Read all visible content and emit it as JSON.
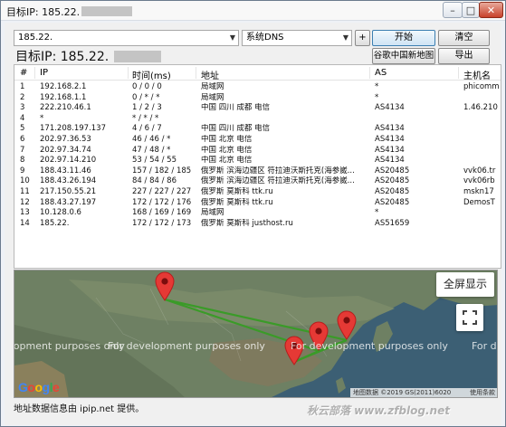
{
  "window": {
    "title": "目标IP: 185.22.",
    "minimize": "–",
    "maximize": "□",
    "close": "✕"
  },
  "toolbar": {
    "target_value": "185.22.",
    "dns_value": "系统DNS",
    "plus_label": "+",
    "start_label": "开始",
    "clear_label": "清空",
    "google_map_label": "谷歌中国新地图",
    "export_label": "导出",
    "big_target_label": "目标IP:  185.22."
  },
  "table": {
    "headers": {
      "num": "#",
      "ip": "IP",
      "time": "时间(ms)",
      "addr": "地址",
      "as": "AS",
      "host": "主机名"
    },
    "rows": [
      {
        "num": "1",
        "ip": "192.168.2.1",
        "time": "0 / 0 / 0",
        "addr": "局域网",
        "as": "*",
        "host": "phicomm"
      },
      {
        "num": "2",
        "ip": "192.168.1.1",
        "time": "0 / * / *",
        "addr": "局域网",
        "as": "*",
        "host": ""
      },
      {
        "num": "3",
        "ip": "222.210.46.1",
        "time": "1 / 2 / 3",
        "addr": "中国 四川 成都 电信",
        "as": "AS4134",
        "host": "1.46.210"
      },
      {
        "num": "4",
        "ip": "*",
        "time": "* / * / *",
        "addr": "",
        "as": "",
        "host": ""
      },
      {
        "num": "5",
        "ip": "171.208.197.137",
        "time": "4 / 6 / 7",
        "addr": "中国 四川 成都 电信",
        "as": "AS4134",
        "host": ""
      },
      {
        "num": "6",
        "ip": "202.97.36.53",
        "time": "46 / 46 / *",
        "addr": "中国 北京 电信",
        "as": "AS4134",
        "host": ""
      },
      {
        "num": "7",
        "ip": "202.97.34.74",
        "time": "47 / 48 / *",
        "addr": "中国 北京 电信",
        "as": "AS4134",
        "host": ""
      },
      {
        "num": "8",
        "ip": "202.97.14.210",
        "time": "53 / 54 / 55",
        "addr": "中国 北京 电信",
        "as": "AS4134",
        "host": ""
      },
      {
        "num": "9",
        "ip": "188.43.11.46",
        "time": "157 / 182 / 185",
        "addr": "俄罗斯 滨海边疆区 符拉迪沃斯托克(海参崴...",
        "as": "AS20485",
        "host": "vvk06.tr"
      },
      {
        "num": "10",
        "ip": "188.43.26.194",
        "time": "84 / 84 / 86",
        "addr": "俄罗斯 滨海边疆区 符拉迪沃斯托克(海参崴...",
        "as": "AS20485",
        "host": "vvk06rb"
      },
      {
        "num": "11",
        "ip": "217.150.55.21",
        "time": "227 / 227 / 227",
        "addr": "俄罗斯 莫斯科 ttk.ru",
        "as": "AS20485",
        "host": "mskn17"
      },
      {
        "num": "12",
        "ip": "188.43.27.197",
        "time": "172 / 172 / 176",
        "addr": "俄罗斯 莫斯科 ttk.ru",
        "as": "AS20485",
        "host": "DemosT"
      },
      {
        "num": "13",
        "ip": "10.128.0.6",
        "time": "168 / 169 / 169",
        "addr": "局域网",
        "as": "*",
        "host": ""
      },
      {
        "num": "14",
        "ip": "185.22.",
        "time": "172 / 172 / 173",
        "addr": "俄罗斯 莫斯科 justhost.ru",
        "as": "AS51659",
        "host": ""
      }
    ]
  },
  "map": {
    "fullscreen_label": "全屏显示",
    "expand_icon": "expand-icon",
    "dev_text": "For development purposes only",
    "google_logo": "Google",
    "credit": "地图数据 ©2019 GS(2011)6020",
    "terms": "使用条款",
    "markers": [
      "moscow-marker",
      "beijing-marker",
      "vladivostok-marker",
      "chengdu-marker"
    ]
  },
  "status": {
    "text": "地址数据信息由 ipip.net 提供。"
  },
  "watermark": {
    "text": "秋云部落 www.zfblog.net"
  },
  "colors": {
    "marker_red": "#e53935",
    "route_green": "#3a9b28",
    "map_water": "#3c5f74",
    "map_land": "#6e8063",
    "window_frame": "#6b7b8e"
  }
}
